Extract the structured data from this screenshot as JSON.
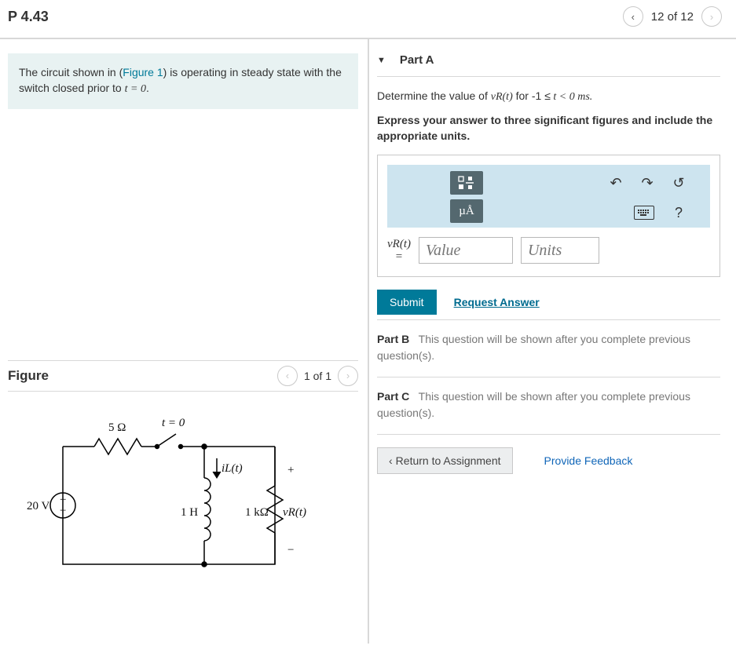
{
  "header": {
    "title": "P 4.43",
    "nav_label": "12 of 12"
  },
  "prompt": {
    "pre": "The circuit shown in (",
    "link": "Figure 1",
    "post_a": ") is operating in steady state with the switch closed prior to ",
    "eqn": "t = 0",
    "post_b": "."
  },
  "figure": {
    "title": "Figure",
    "nav_label": "1 of 1",
    "labels": {
      "source": "20 V",
      "r1": "5 Ω",
      "switch": "t = 0",
      "iL": "iL(t)",
      "L": "1 H",
      "r2": "1 kΩ",
      "vR": "vR(t)",
      "plus": "+",
      "minus": "−"
    }
  },
  "partA": {
    "title": "Part A",
    "question_pre": "Determine the value of ",
    "vr": "vR(t)",
    "question_mid": " for -1 ",
    "le": "≤",
    "tlt": " t < 0 ms.",
    "instruction": "Express your answer to three significant figures and include the appropriate units.",
    "toolbar": {
      "mu_btn": "µÅ",
      "help": "?"
    },
    "answer_label_top": "vR(t)",
    "answer_label_eq": "=",
    "value_placeholder": "Value",
    "units_placeholder": "Units",
    "submit": "Submit",
    "request": "Request Answer"
  },
  "parts_locked": [
    {
      "title": "Part B",
      "msg": "This question will be shown after you complete previous question(s)."
    },
    {
      "title": "Part C",
      "msg": "This question will be shown after you complete previous question(s)."
    }
  ],
  "footer": {
    "return_btn": "Return to Assignment",
    "feedback": "Provide Feedback"
  }
}
